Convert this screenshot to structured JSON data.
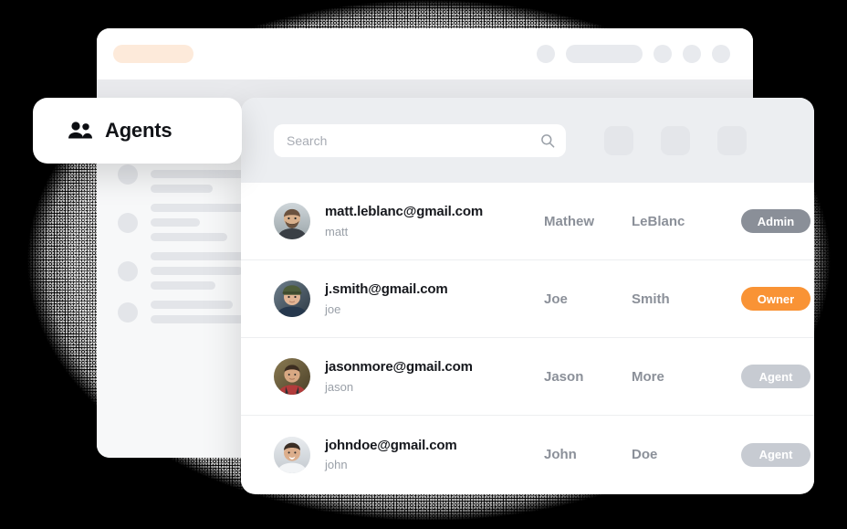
{
  "window": {
    "url_pill": "",
    "toolbar_right_items": [
      "dot",
      "bar",
      "dot",
      "dot",
      "dot"
    ]
  },
  "agents_card": {
    "title": "Agents",
    "icon": "people-icon"
  },
  "panel": {
    "search": {
      "value": "",
      "placeholder": "Search",
      "icon": "search-icon"
    },
    "actions": [
      "action-box-1",
      "action-box-2",
      "action-box-3"
    ]
  },
  "colors": {
    "accent_orange": "#f99335",
    "badge_admin": "#8a8f98",
    "badge_agent": "#c7cbd2",
    "toolbar_bg": "#eceef1",
    "url_pill": "#fdeada",
    "page_bg": "#000000"
  },
  "table": {
    "rows": [
      {
        "email": "matt.leblanc@gmail.com",
        "handle": "matt",
        "first_name": "Mathew",
        "last_name": "LeBlanc",
        "role": "Admin",
        "role_style": "admin",
        "avatar": "avatar-matt"
      },
      {
        "email": "j.smith@gmail.com",
        "handle": "joe",
        "first_name": "Joe",
        "last_name": "Smith",
        "role": "Owner",
        "role_style": "owner",
        "avatar": "avatar-joe"
      },
      {
        "email": "jasonmore@gmail.com",
        "handle": "jason",
        "first_name": "Jason",
        "last_name": "More",
        "role": "Agent",
        "role_style": "agent",
        "avatar": "avatar-jason"
      },
      {
        "email": "johndoe@gmail.com",
        "handle": "john",
        "first_name": "John",
        "last_name": "Doe",
        "role": "Agent",
        "role_style": "agent",
        "avatar": "avatar-john"
      }
    ]
  }
}
